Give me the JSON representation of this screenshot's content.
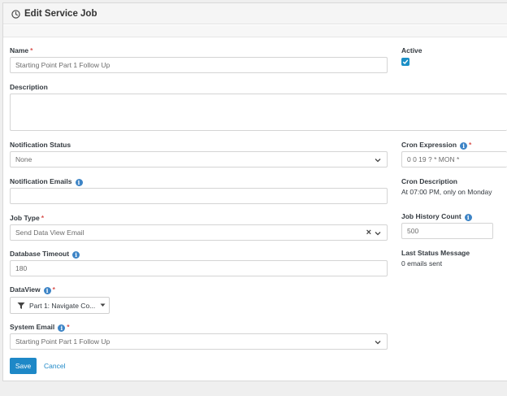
{
  "header": {
    "title": "Edit Service Job",
    "icon": "clock-icon"
  },
  "form": {
    "name": {
      "label": "Name",
      "required": "*",
      "value": "Starting Point Part 1 Follow Up"
    },
    "active": {
      "label": "Active",
      "checked": true
    },
    "description": {
      "label": "Description",
      "value": ""
    },
    "notification_status": {
      "label": "Notification Status",
      "value": "None"
    },
    "cron_expression": {
      "label": "Cron Expression",
      "required": "*",
      "value": "0 0 19 ? * MON *"
    },
    "notification_emails": {
      "label": "Notification Emails",
      "value": ""
    },
    "cron_description": {
      "label": "Cron Description",
      "value": "At 07:00 PM, only on Monday"
    },
    "job_type": {
      "label": "Job Type",
      "required": "*",
      "value": "Send Data View Email",
      "clear": "×"
    },
    "job_history_count": {
      "label": "Job History Count",
      "value": "500"
    },
    "database_timeout": {
      "label": "Database Timeout",
      "value": "180"
    },
    "last_status": {
      "label": "Last Status Message",
      "value": "0 emails sent"
    },
    "dataview": {
      "label": "DataView",
      "required": "*",
      "value": "Part 1: Navigate Co..."
    },
    "system_email": {
      "label": "System Email",
      "required": "*",
      "value": "Starting Point Part 1 Follow Up"
    }
  },
  "actions": {
    "save": "Save",
    "cancel": "Cancel"
  },
  "colors": {
    "accent": "#1e88c7",
    "required": "#d9534f",
    "info": "#3d84c6"
  }
}
